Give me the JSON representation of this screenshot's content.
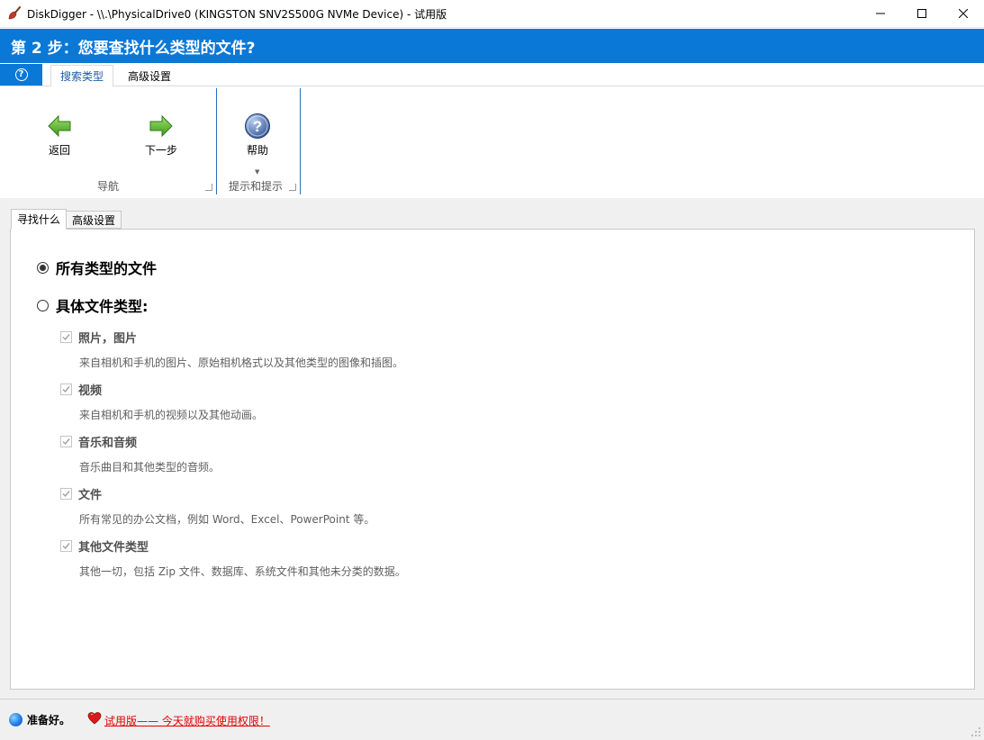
{
  "window": {
    "title": "DiskDigger - \\\\.\\PhysicalDrive0 (KINGSTON SNV2S500G NVMe Device) - 试用版",
    "controls": {
      "minimize": "minimize-icon",
      "maximize": "maximize-icon",
      "close": "close-icon"
    }
  },
  "step": {
    "title": "第 2 步：您要查找什么类型的文件?"
  },
  "ribbon": {
    "help_tab_icon": "question-icon",
    "tabs": [
      {
        "label": "搜索类型",
        "active": true
      },
      {
        "label": "高级设置",
        "active": false
      }
    ],
    "buttons": {
      "back": "返回",
      "next": "下一步",
      "help": "帮助"
    },
    "groups": {
      "navigation": "导航",
      "hints": "提示和提示"
    }
  },
  "inner_tabs": [
    {
      "label": "寻找什么",
      "active": true
    },
    {
      "label": "高级设置",
      "active": false
    }
  ],
  "options": {
    "all_types": {
      "label": "所有类型的文件",
      "selected": true
    },
    "specific_types": {
      "label": "具体文件类型:",
      "selected": false
    }
  },
  "file_types": [
    {
      "label": "照片，图片",
      "description": "来自相机和手机的图片、原始相机格式以及其他类型的图像和插图。",
      "checked": true
    },
    {
      "label": "视频",
      "description": "来自相机和手机的视频以及其他动画。",
      "checked": true
    },
    {
      "label": "音乐和音频",
      "description": "音乐曲目和其他类型的音频。",
      "checked": true
    },
    {
      "label": "文件",
      "description": "所有常见的办公文档，例如 Word、Excel、PowerPoint 等。",
      "checked": true
    },
    {
      "label": "其他文件类型",
      "description": "其他一切，包括 Zip 文件、数据库、系统文件和其他未分类的数据。",
      "checked": true
    }
  ],
  "status": {
    "text": "准备好。",
    "trial_link": "试用版—— 今天就购买使用权限！"
  },
  "colors": {
    "accent": "#0a78d7",
    "link": "#e00000"
  }
}
